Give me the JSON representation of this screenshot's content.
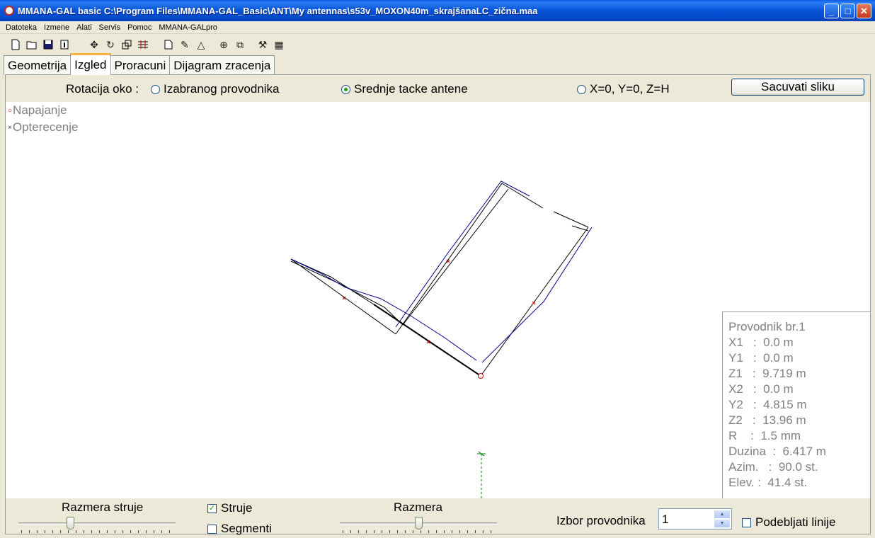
{
  "window": {
    "title": "MMANA-GAL basic C:\\Program Files\\MMANA-GAL_Basic\\ANT\\My antennas\\s53v_MOXON40m_skrajšanaLC_zična.maa",
    "minimize": "_",
    "maximize": "□",
    "close": "✕"
  },
  "menu": [
    "Datoteka",
    "Izmene",
    "Alati",
    "Servis",
    "Pomoc",
    "MMANA-GALpro"
  ],
  "toolbar_icons": [
    "new-file-icon",
    "open-folder-icon",
    "save-icon",
    "info-icon",
    "move-icon",
    "rotate-icon",
    "scale-icon",
    "wire-edit-icon",
    "document-icon",
    "pencil-icon",
    "triangle-icon",
    "crosshair-icon",
    "copy-icon",
    "tools-icon",
    "calculator-icon"
  ],
  "tabs": {
    "geometrija": "Geometrija",
    "izgled": "Izgled",
    "proracuni": "Proracuni",
    "dijagram": "Dijagram zracenja"
  },
  "rotation": {
    "label": "Rotacija oko :",
    "opt1": "Izabranog provodnika",
    "opt2": "Srednje tacke antene",
    "opt3": "X=0, Y=0, Z=H",
    "selected": "opt2"
  },
  "save_button": "Sacuvati sliku",
  "legend": {
    "feed": "Napajanje",
    "load": "Opterecenje"
  },
  "wire_info": {
    "title": "Provodnik br.1",
    "x1": "X1   :  0.0 m",
    "y1": "Y1   :  0.0 m",
    "z1": "Z1   :  9.719 m",
    "x2": "X2   :  0.0 m",
    "y2": "Y2   :  4.815 m",
    "z2": "Z2   :  13.96 m",
    "r": "R    :  1.5 mm",
    "duzina": "Duzina  :  6.417 m",
    "azim": "Azim.   :  90.0 st.",
    "elev": "Elev. :  41.4 st."
  },
  "bottom": {
    "current_scale_label": "Razmera struje",
    "current_scale_value": 0.32,
    "struje_label": "Struje",
    "struje_checked": true,
    "segmenti_label": "Segmenti",
    "segmenti_checked": false,
    "scale_label": "Razmera",
    "scale_value": 0.5,
    "wire_select_label": "Izbor provodnika",
    "wire_select_value": "1",
    "bold_lines_label": "Podebljati linije",
    "bold_lines_checked": false
  },
  "colors": {
    "wire": "#000000",
    "current": "#00008b",
    "feed_marker": "#c00000",
    "ground": "#008000"
  }
}
